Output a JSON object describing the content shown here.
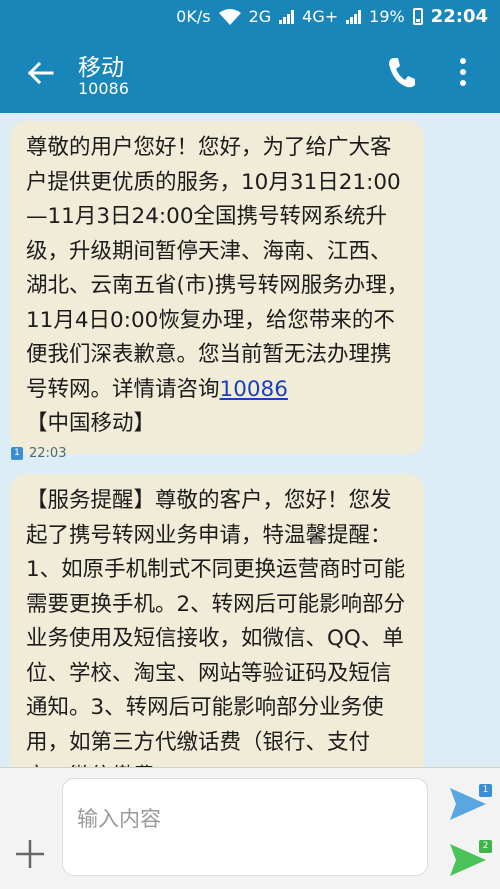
{
  "status_bar": {
    "net_speed": "0K/s",
    "network_2g": "2G",
    "network_4g": "4G+",
    "battery": "19%",
    "time": "22:04"
  },
  "header": {
    "title": "移动",
    "number": "10086"
  },
  "messages": [
    {
      "text_before_link": "尊敬的用户您好！您好，为了给广大客户提供更优质的服务，10月31日21:00—11月3日24:00全国携号转网系统升级，升级期间暂停天津、海南、江西、湖北、云南五省(市)携号转网服务办理，11月4日0:00恢复办理，给您带来的不便我们深表歉意。您当前暂无法办理携号转网。详情请咨询",
      "link": "10086",
      "text_after_link": "【中国移动】",
      "sim": "1",
      "time": "22:03"
    },
    {
      "text": "【服务提醒】尊敬的客户，您好！您发起了携号转网业务申请，特温馨提醒：1、如原手机制式不同更换运营商时可能需要更换手机。2、转网后可能影响部分业务使用及短信接收，如微信、QQ、单位、学校、淘宝、网站等验证码及短信通知。3、转网后可能影响部分业务使用，如第三方代缴话费（银行、支付宝、微信缴费"
    }
  ],
  "input": {
    "placeholder": "输入内容",
    "sim1": "1",
    "sim2": "2"
  },
  "colors": {
    "header": "#1886b8",
    "background": "#dcedf6",
    "bubble": "#f1ecd8",
    "link": "#1a3fc0",
    "send1": "#3b8ed2",
    "send2": "#3eb449"
  }
}
